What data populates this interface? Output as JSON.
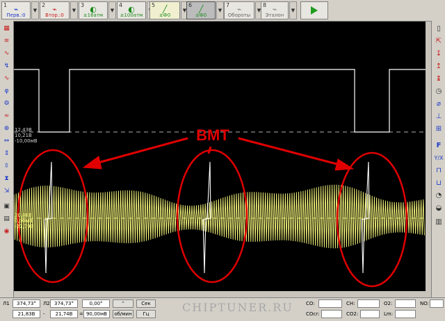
{
  "toolbar": {
    "channels": [
      {
        "num": "1",
        "label": "Перв.:0",
        "color": "#1e3cc8"
      },
      {
        "num": "2",
        "label": "Втор.:0",
        "color": "#c81e1e"
      },
      {
        "num": "3",
        "label": "±16атм",
        "color": "#1e8c1e"
      },
      {
        "num": "4",
        "label": "±100атм",
        "color": "#1e8c1e"
      },
      {
        "num": "5",
        "label": "±Ф0",
        "color": "#1e8c1e"
      },
      {
        "num": "6",
        "label": "±Ф0",
        "color": "#1e8c1e"
      },
      {
        "num": "7",
        "label": "Обороты",
        "color": "#666666"
      },
      {
        "num": "8",
        "label": "Эталон",
        "color": "#666666"
      }
    ],
    "play_icon": "play-icon"
  },
  "scope": {
    "labels_ch1": [
      "12,43В",
      "10,21В",
      "-10,00мВ"
    ],
    "labels_ch2": [
      "20,88В",
      "0,00мВ",
      "-21,79В"
    ],
    "annotation": "BMT",
    "trace_colors": {
      "digital": "#ffffff",
      "analog": "#ffff80",
      "marker": "#ff0000"
    }
  },
  "bottom": {
    "l1_label": "Л1",
    "l1_value": "374,73°",
    "l2_label": "Л2",
    "l2_value": "374,73°",
    "angle_value": "0,00°",
    "sec_button": "Сек",
    "row2_left": "21,83В",
    "row2_dash": "-",
    "row2_mid": "21,74В",
    "row2_eq": "=",
    "row2_val": "90,00мВ",
    "row2_btn": "об/мин",
    "hz_button": "Гц",
    "co_label": "CO:",
    "ch_label": "CH:",
    "o2_label": "O2:",
    "no_label": "NO:",
    "coc_label": "COcr:",
    "co2_label": "CO2:",
    "lm_label": "Lm:",
    "watermark": "CHIPTUNER.RU"
  }
}
